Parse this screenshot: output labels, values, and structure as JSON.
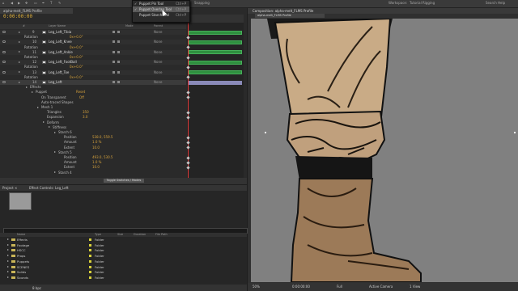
{
  "toolbar": {
    "left_labels": [
      "⌂",
      "◀",
      "▶",
      "✥",
      "▭",
      "✒",
      "T",
      "✎"
    ],
    "snapping": "Snapping",
    "right_label": "Workspace:",
    "workspace": "Tutorial Rigging",
    "search_placeholder": "Search Help"
  },
  "puppet_menu": {
    "items": [
      {
        "label": "Puppet Pin Tool",
        "shortcut": "Ctrl+P",
        "checked": true,
        "highlighted": false
      },
      {
        "label": "Puppet Overlap Tool",
        "shortcut": "Ctrl+P",
        "checked": true,
        "highlighted": true
      },
      {
        "label": "Puppet Starch Tool",
        "shortcut": "Ctrl+P",
        "checked": false,
        "highlighted": false
      }
    ]
  },
  "timeline": {
    "tab": "alpha-melt_FLMS Profile",
    "timecode": "0:00:00:00",
    "columns": [
      "#",
      "Layer Name",
      "Mode",
      "Parent"
    ],
    "cti_label": "0:00f",
    "toggle_label": "Toggle Switches / Modes",
    "rows": [
      {
        "kind": "layer",
        "num": "9",
        "name": "Leg_Left_Tibia",
        "parent": "None",
        "bar": "green"
      },
      {
        "kind": "prop",
        "name": "Rotation",
        "value": "0x+0.0°"
      },
      {
        "kind": "layer",
        "num": "10",
        "name": "Leg_Left_Knee",
        "parent": "None",
        "bar": "green"
      },
      {
        "kind": "prop",
        "name": "Rotation",
        "value": "0x+0.0°"
      },
      {
        "kind": "layer",
        "num": "11",
        "name": "Leg_Left_Ankle",
        "parent": "None",
        "bar": "green"
      },
      {
        "kind": "prop",
        "name": "Rotation",
        "value": "0x+0.0°"
      },
      {
        "kind": "layer",
        "num": "12",
        "name": "Leg_Left_FootBall",
        "parent": "None",
        "bar": "green"
      },
      {
        "kind": "prop",
        "name": "Rotation",
        "value": "0x+0.0°"
      },
      {
        "kind": "layer",
        "num": "13",
        "name": "Leg_Left_Toe",
        "parent": "None",
        "bar": "green"
      },
      {
        "kind": "prop",
        "name": "Rotation",
        "value": "0x+0.0°"
      },
      {
        "kind": "layer",
        "num": "14",
        "name": "Leg_Left",
        "parent": "None",
        "bar": "purple",
        "selected": true
      },
      {
        "kind": "group",
        "name": "Effects",
        "indent": 1
      },
      {
        "kind": "group",
        "name": "Puppet",
        "indent": 2,
        "value": "Reset"
      },
      {
        "kind": "prop",
        "name": "On Transparent",
        "indent": 3,
        "value": "Off"
      },
      {
        "kind": "prop",
        "name": "Auto-traced Shapes",
        "indent": 3
      },
      {
        "kind": "group",
        "name": "Mesh 1",
        "indent": 3
      },
      {
        "kind": "prop",
        "name": "Triangles",
        "indent": 4,
        "value": "350"
      },
      {
        "kind": "prop",
        "name": "Expansion",
        "indent": 4,
        "value": "3.0"
      },
      {
        "kind": "group",
        "name": "Deform",
        "indent": 4
      },
      {
        "kind": "group",
        "name": "Stiffness",
        "indent": 5
      },
      {
        "kind": "group",
        "name": "Starch 6",
        "indent": 6
      },
      {
        "kind": "prop",
        "name": "Position",
        "indent": 7,
        "value": "538.0, 559.5"
      },
      {
        "kind": "prop",
        "name": "Amount",
        "indent": 7,
        "value": "1.0 %"
      },
      {
        "kind": "prop",
        "name": "Extent",
        "indent": 7,
        "value": "10.0"
      },
      {
        "kind": "group",
        "name": "Starch 5",
        "indent": 6
      },
      {
        "kind": "prop",
        "name": "Position",
        "indent": 7,
        "value": "493.0, 530.5"
      },
      {
        "kind": "prop",
        "name": "Amount",
        "indent": 7,
        "value": "1.0 %"
      },
      {
        "kind": "prop",
        "name": "Extent",
        "indent": 7,
        "value": "10.0"
      },
      {
        "kind": "group",
        "name": "Starch 4",
        "indent": 6
      }
    ]
  },
  "project": {
    "tabs": [
      "Project ×",
      "Effect Controls: Leg_Left"
    ],
    "columns": [
      "Name",
      "Type",
      "Size",
      "Duration",
      "File Path"
    ],
    "items": [
      {
        "name": "Effects",
        "type": "Folder"
      },
      {
        "name": "Footage",
        "type": "Folder"
      },
      {
        "name": "HSCC",
        "type": "Folder"
      },
      {
        "name": "Props",
        "type": "Folder"
      },
      {
        "name": "Puppets",
        "type": "Folder"
      },
      {
        "name": "SCENES",
        "type": "Folder"
      },
      {
        "name": "Solids",
        "type": "Folder"
      },
      {
        "name": "Sounds",
        "type": "Folder"
      }
    ],
    "footer": "8 bpc"
  },
  "composition": {
    "tab": "Composition: alpha-melt_FLMS Profile",
    "subtab": "alpha-melt_FLMS Profile",
    "footer": [
      "50%",
      "0:00:00:00",
      "Full",
      "Active Camera",
      "1 View"
    ]
  },
  "colors": {
    "timecode": "#e0b13c",
    "layer_bar": "#2f8f3f",
    "selected_bar": "#8a8ab8",
    "cti": "#e23a3a",
    "pant": "#c9ab86",
    "boot": "#9c7a58"
  }
}
